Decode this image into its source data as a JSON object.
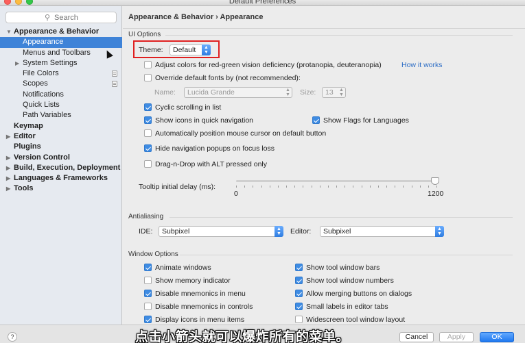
{
  "window": {
    "title": "Default Preferences"
  },
  "search": {
    "placeholder": "Search"
  },
  "sidebar": {
    "items": [
      {
        "label": "Appearance & Behavior",
        "arrow": "▼"
      },
      {
        "label": "Appearance"
      },
      {
        "label": "Menus and Toolbars"
      },
      {
        "label": "System Settings",
        "arrow": "▶"
      },
      {
        "label": "File Colors"
      },
      {
        "label": "Scopes"
      },
      {
        "label": "Notifications"
      },
      {
        "label": "Quick Lists"
      },
      {
        "label": "Path Variables"
      },
      {
        "label": "Keymap"
      },
      {
        "label": "Editor",
        "arrow": "▶"
      },
      {
        "label": "Plugins"
      },
      {
        "label": "Version Control",
        "arrow": "▶"
      },
      {
        "label": "Build, Execution, Deployment",
        "arrow": "▶"
      },
      {
        "label": "Languages & Frameworks",
        "arrow": "▶"
      },
      {
        "label": "Tools",
        "arrow": "▶"
      }
    ]
  },
  "main": {
    "breadcrumb": "Appearance & Behavior › Appearance",
    "ui_options": {
      "title": "UI Options",
      "theme_label": "Theme:",
      "theme_value": "Default",
      "adjust_colors": "Adjust colors for red-green vision deficiency (protanopia, deuteranopia)",
      "how_it_works": "How it works",
      "override_fonts": "Override default fonts by (not recommended):",
      "name_label": "Name:",
      "name_value": "Lucida Grande",
      "size_label": "Size:",
      "size_value": "13",
      "cyclic_scrolling": "Cyclic scrolling in list",
      "show_icons_nav": "Show icons in quick navigation",
      "show_flags": "Show Flags for Languages",
      "auto_position": "Automatically position mouse cursor on default button",
      "hide_popups": "Hide navigation popups on focus loss",
      "drag_drop": "Drag-n-Drop with ALT pressed only",
      "tooltip_label": "Tooltip initial delay (ms):",
      "tooltip_min": "0",
      "tooltip_max": "1200",
      "tooltip_value": 1200
    },
    "antialiasing": {
      "title": "Antialiasing",
      "ide_label": "IDE:",
      "ide_value": "Subpixel",
      "editor_label": "Editor:",
      "editor_value": "Subpixel"
    },
    "window_options": {
      "title": "Window Options",
      "animate_windows": "Animate windows",
      "show_memory": "Show memory indicator",
      "disable_mnemonics_menu": "Disable mnemonics in menu",
      "disable_mnemonics_controls": "Disable mnemonics in controls",
      "display_icons_menu": "Display icons in menu items",
      "show_tool_bars": "Show tool window bars",
      "show_tool_numbers": "Show tool window numbers",
      "allow_merging": "Allow merging buttons on dialogs",
      "small_labels": "Small labels in editor tabs",
      "widescreen": "Widescreen tool window layout"
    }
  },
  "footer": {
    "help": "?",
    "cancel": "Cancel",
    "apply": "Apply",
    "ok": "OK"
  },
  "overlay": {
    "subtitle": "点击小箭头就可以爆炸所有的菜单。"
  },
  "colors": {
    "accent": "#3e83d8",
    "highlight_box": "#e02020",
    "link": "#2a6bc4"
  }
}
